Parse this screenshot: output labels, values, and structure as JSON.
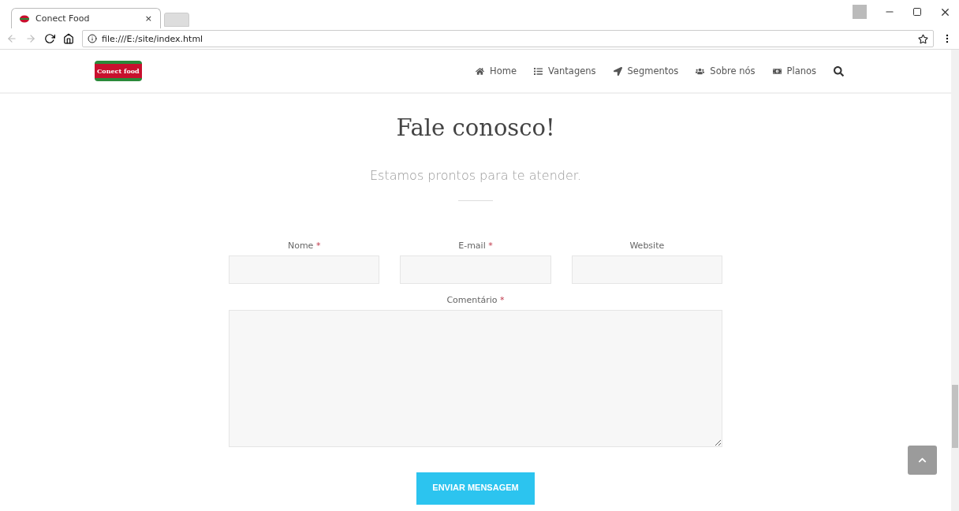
{
  "browser": {
    "tab": {
      "title": "Conect Food",
      "close": "×"
    },
    "address": "file:///E:/site/index.html"
  },
  "site": {
    "logo": {
      "text": "Conect food"
    },
    "nav": [
      {
        "kind": "home",
        "label": "Home"
      },
      {
        "kind": "list",
        "label": "Vantagens"
      },
      {
        "kind": "arrow",
        "label": "Segmentos"
      },
      {
        "kind": "users",
        "label": "Sobre nós"
      },
      {
        "kind": "money",
        "label": "Planos"
      },
      {
        "kind": "search"
      }
    ]
  },
  "contact": {
    "title": "Fale conosco!",
    "subtitle": "Estamos prontos para te atender.",
    "fields": [
      {
        "label": "Nome",
        "required": true
      },
      {
        "label": "E-mail",
        "required": true
      },
      {
        "label": "Website",
        "required": false
      }
    ],
    "comment": {
      "label": "Comentário",
      "required": true
    },
    "submit": "ENVIAR MENSAGEM",
    "required_mark": "*"
  }
}
